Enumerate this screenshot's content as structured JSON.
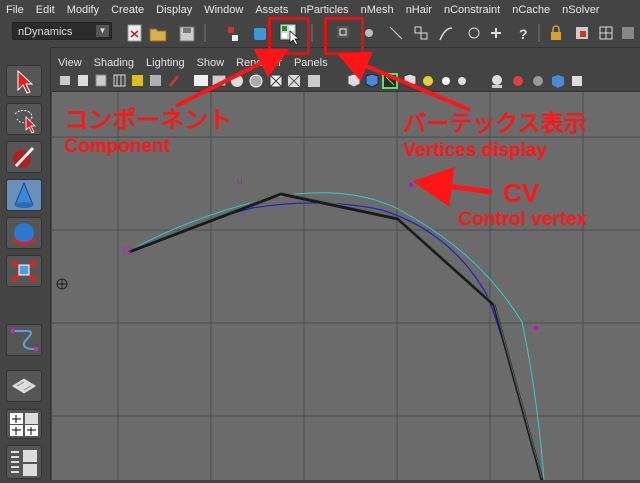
{
  "menu": [
    "File",
    "Edit",
    "Modify",
    "Create",
    "Display",
    "Window",
    "Assets",
    "nParticles",
    "nMesh",
    "nHair",
    "nConstraint",
    "nCache",
    "nSolver"
  ],
  "mode_selector": {
    "value": "nDynamics"
  },
  "viewport_menu": [
    "View",
    "Shading",
    "Lighting",
    "Show",
    "Renderer",
    "Panels"
  ],
  "annotations": {
    "component_jp": "コンポーネント",
    "component_en": "Component",
    "vertices_jp": "バーテックス表示",
    "vertices_en": "Vertices display",
    "cv": "CV",
    "cv_en": "Control vertex"
  },
  "curve_label": "u",
  "colors": {
    "highlight": "#e01010",
    "grid": "#4a4a4a",
    "curve": "#1e1ec8",
    "nurbs_hull": "#2a2a2a",
    "cv_point": "#b020b0",
    "edit_point": "#40d0d0"
  },
  "icons": [
    "select-arrow-icon",
    "lasso-icon",
    "paint-select-icon",
    "move-icon",
    "rotate-icon",
    "scale-icon",
    "component-mode-icon",
    "vertex-display-icon",
    "curve-tool-icon",
    "plane-icon"
  ]
}
